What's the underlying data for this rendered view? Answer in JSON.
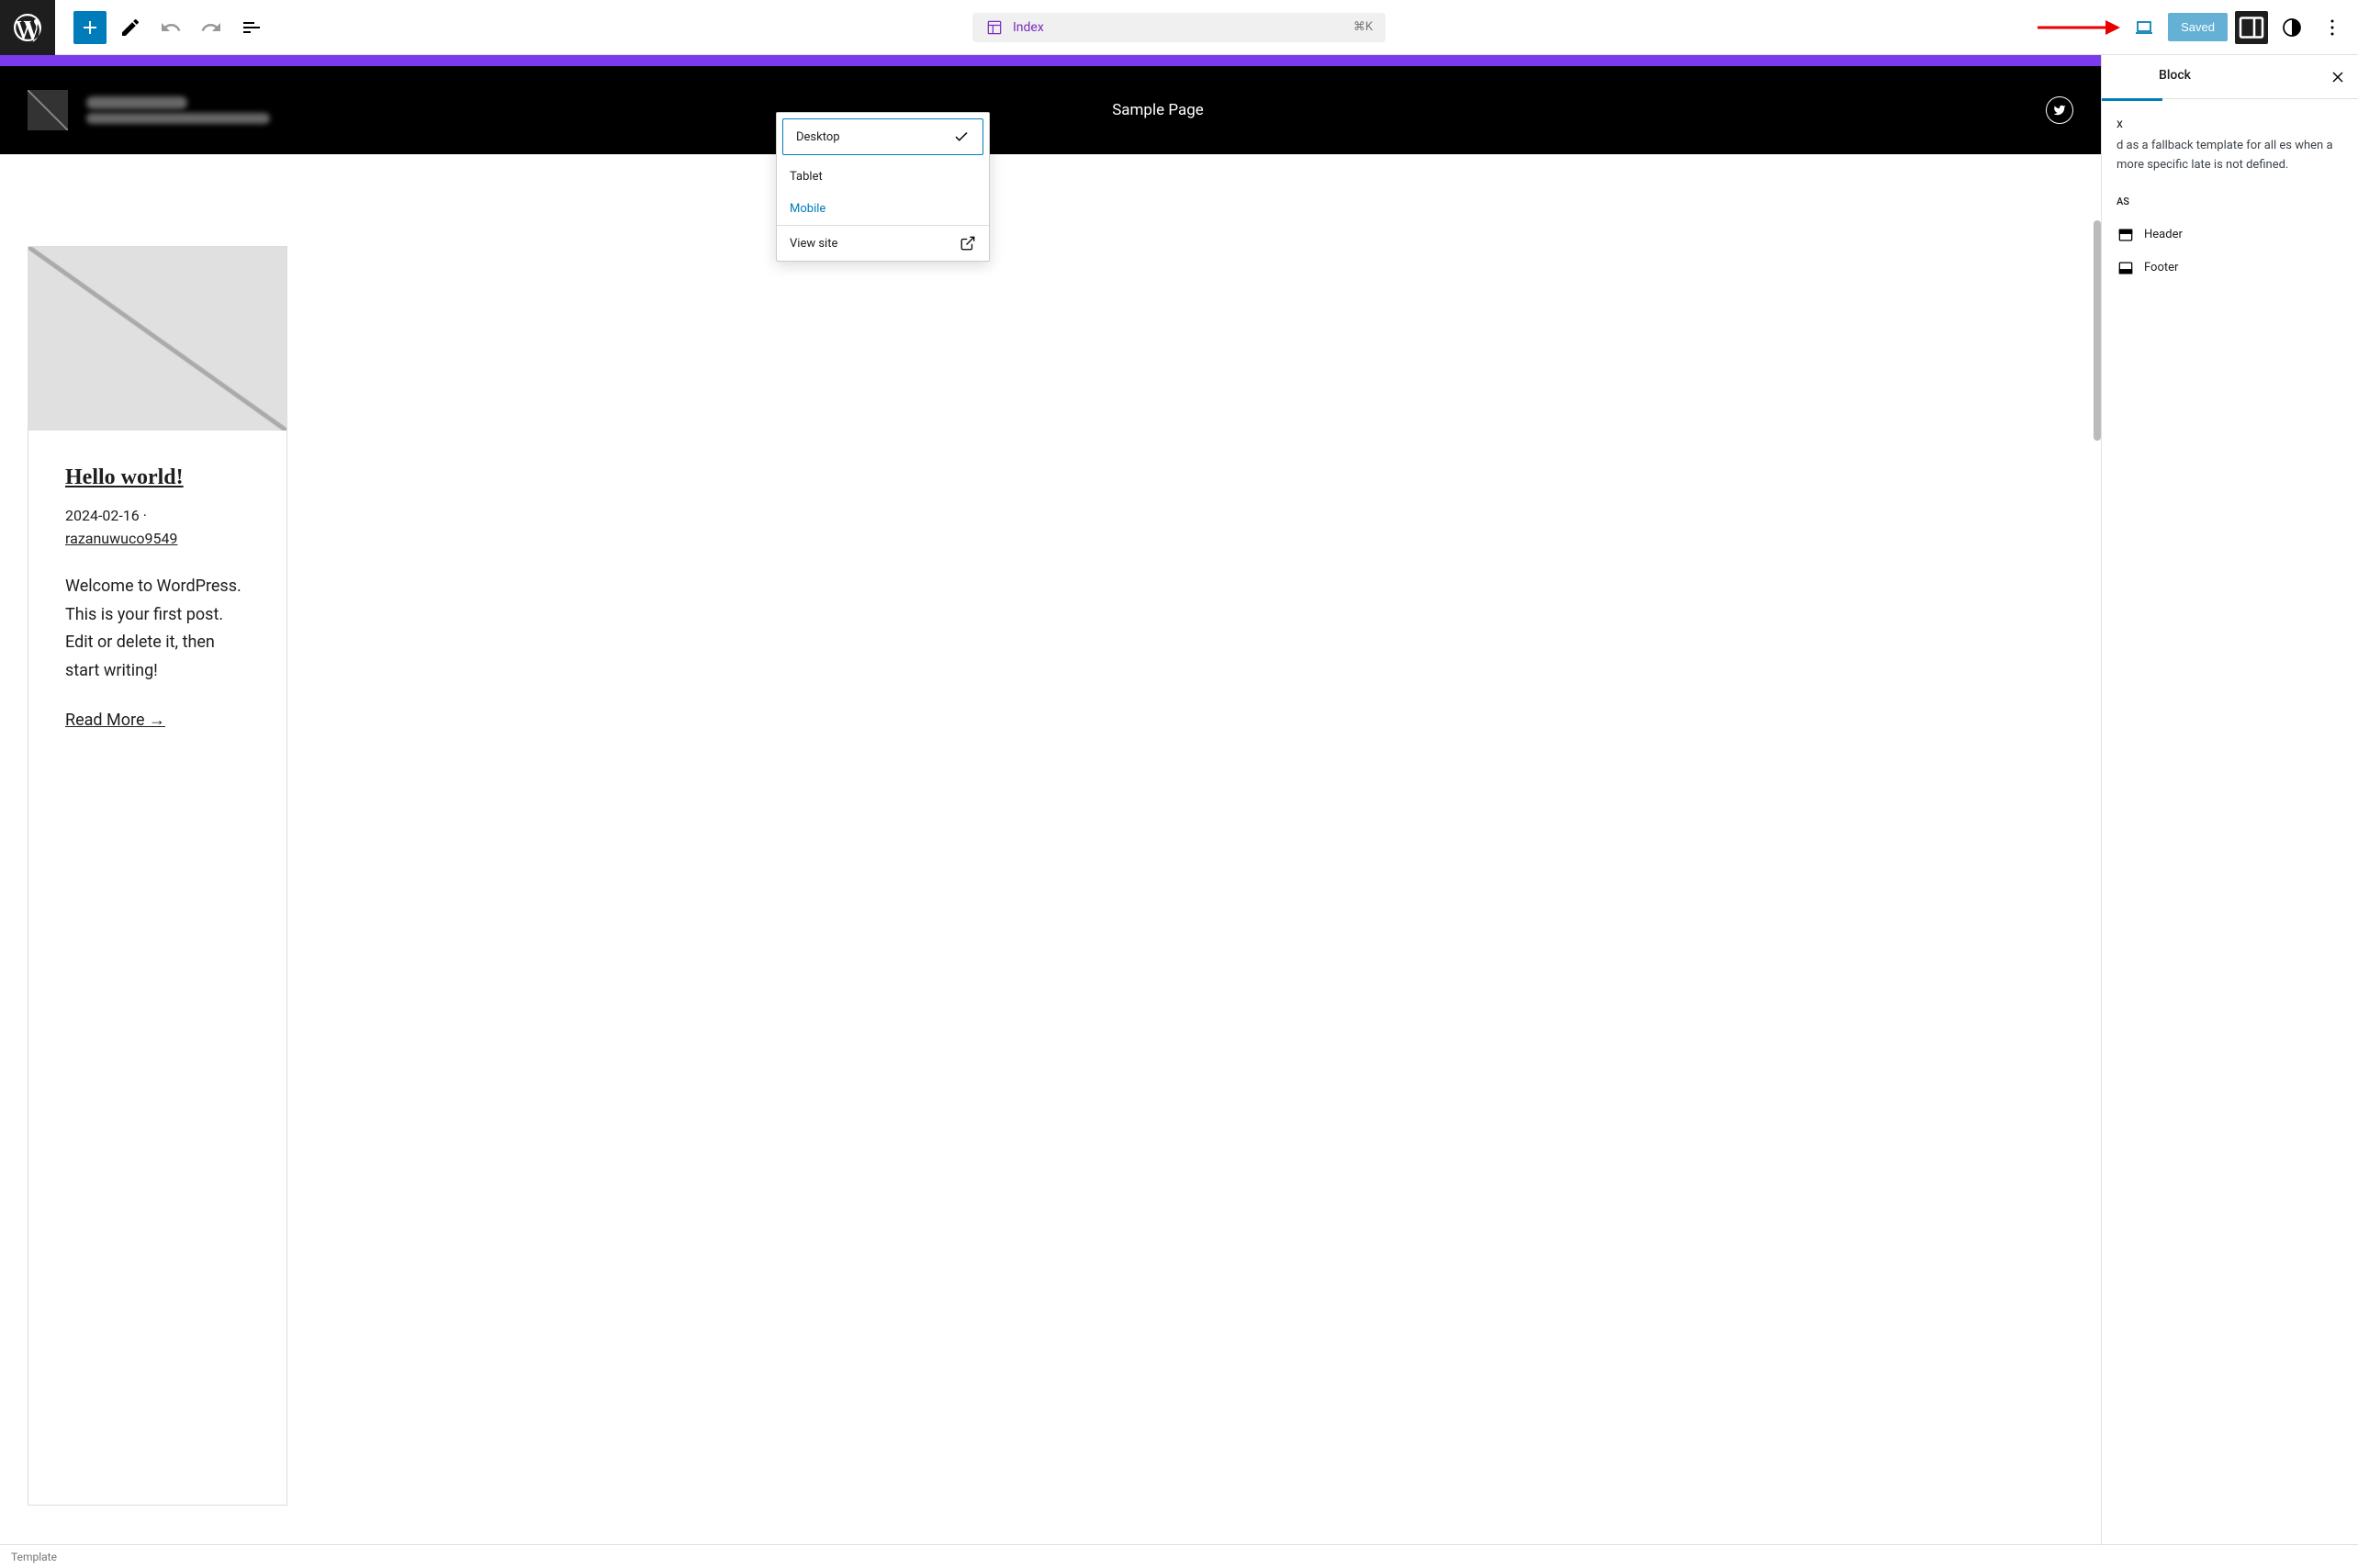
{
  "toolbar": {
    "document_label": "Index",
    "shortcut": "⌘K",
    "saved_label": "Saved"
  },
  "view_menu": {
    "items": [
      {
        "label": "Desktop",
        "selected": true
      },
      {
        "label": "Tablet"
      },
      {
        "label": "Mobile",
        "highlight": true
      }
    ],
    "view_site": "View site"
  },
  "site_header": {
    "nav_item": "Sample Page"
  },
  "post": {
    "title": "Hello world!",
    "date": "2024-02-16",
    "separator": "·",
    "author": "razanuwuco9549",
    "excerpt": "Welcome to WordPress. This is your first post. Edit or delete it, then start writing!",
    "read_more": "Read More →"
  },
  "sidebar": {
    "tab_template_suffix": "x",
    "tab_block": "Block",
    "description_suffix": "d as a fallback template for all es when a more specific late is not defined.",
    "areas_heading_suffix": "AS",
    "areas": [
      {
        "label": "Header"
      },
      {
        "label": "Footer"
      }
    ]
  },
  "footer": {
    "breadcrumb": "Template"
  }
}
